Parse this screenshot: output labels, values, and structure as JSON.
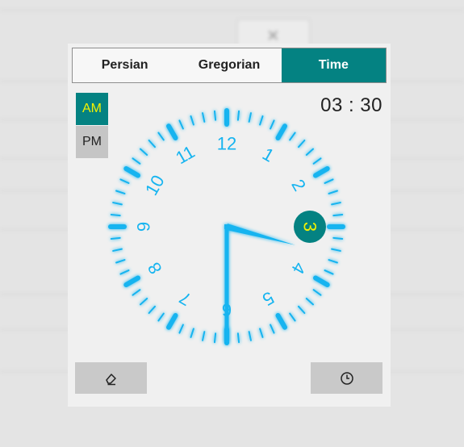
{
  "tabs": {
    "persian": "Persian",
    "gregorian": "Gregorian",
    "time": "Time",
    "active": "Time"
  },
  "period": {
    "am": "AM",
    "pm": "PM",
    "selected": "AM"
  },
  "time": {
    "hour": "03",
    "separator": ":",
    "minute": "30",
    "display": "03 : 30"
  },
  "clock": {
    "numbers": [
      "12",
      "1",
      "2",
      "3",
      "4",
      "5",
      "6",
      "7",
      "8",
      "9",
      "10",
      "11"
    ],
    "selected_hour": "3",
    "hour_value": 3,
    "minute_value": 30
  },
  "buttons": {
    "clear_icon": "eraser-icon",
    "now_icon": "clock-icon"
  },
  "colors": {
    "accent": "#048282",
    "clock_blue": "#16b4f0",
    "am_text": "#f3f200"
  }
}
